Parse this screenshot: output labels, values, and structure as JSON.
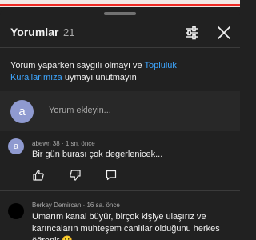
{
  "header": {
    "title": "Yorumlar",
    "count": "21"
  },
  "notice": {
    "text_before": "Yorum yaparken saygılı olmayı ve ",
    "link": "Topluluk Kurallarımıza",
    "text_after": " uymayı unutmayın"
  },
  "add_comment": {
    "avatar_letter": "a",
    "placeholder": "Yorum ekleyin..."
  },
  "comments": [
    {
      "avatar_letter": "a",
      "author": "abewn 38",
      "time": "1 sn. önce",
      "text": "Bir gün burası çok degerlenicek..."
    },
    {
      "author": "Berkay Demircan",
      "time": "16 sa. önce",
      "text": "Umarım kanal büyür, birçok kişiye ulaşırız ve karıncaların muhteşem canlılar olduğunu herkes öğrenir 🙂"
    }
  ],
  "colors": {
    "background": "#212121",
    "accent_link": "#3ea6ff",
    "avatar": "#8f9ad0",
    "progress": "#f02a24"
  }
}
